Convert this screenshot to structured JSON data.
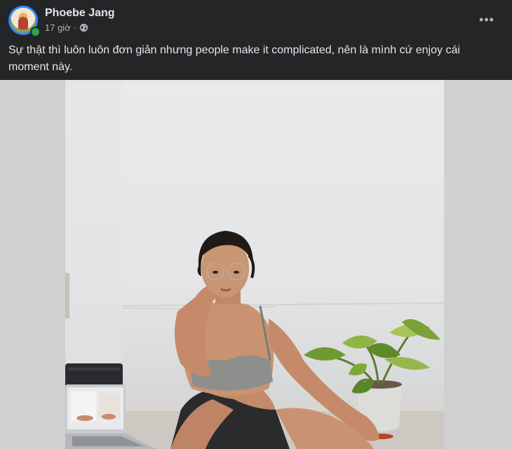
{
  "post": {
    "author": "Phoebe Jang",
    "time": "17 giờ",
    "separator": "·",
    "privacy_icon": "globe-icon",
    "more_icon": "more-horizontal-icon",
    "more_label": "•••",
    "caption": "Sự thật thì luôn luôn đơn giản nhưng people make it complicated, nên là mình cứ enjoy cái moment này."
  },
  "colors": {
    "background": "#242526",
    "text_primary": "#e4e6eb",
    "text_secondary": "#b0b3b8",
    "online": "#31a24c",
    "avatar_ring": "#2d88ff"
  }
}
